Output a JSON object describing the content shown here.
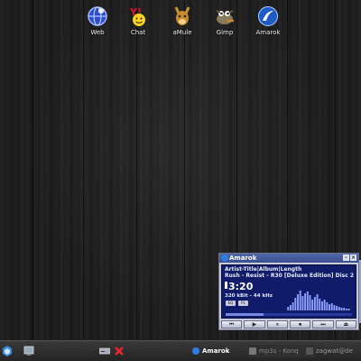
{
  "desktop": {
    "icons": [
      {
        "label": "Web",
        "icon": "web-browser-icon"
      },
      {
        "label": "Chat",
        "icon": "chat-icon"
      },
      {
        "label": "aMule",
        "icon": "amule-icon"
      },
      {
        "label": "Gimp",
        "icon": "gimp-icon"
      },
      {
        "label": "Amarok",
        "icon": "amarok-icon"
      }
    ]
  },
  "amarok": {
    "title": "Amarok",
    "line1": "Artist-Title|Album|Length",
    "line2": "Rush - Resist  -  R30 [Deluxe Edition] Disc 2",
    "time": "3:20",
    "bitrate": "320 kBit - 44 kHz",
    "progress": 0.3,
    "small_btn1": "EQ",
    "small_btn2": "PL",
    "controls": [
      "⏮",
      "▶",
      "⏸",
      "⏹",
      "⏭",
      "⏏"
    ],
    "analyzer_levels": [
      4,
      6,
      9,
      14,
      18,
      22,
      16,
      19,
      21,
      17,
      12,
      15,
      18,
      13,
      10,
      12,
      9,
      7,
      8,
      6,
      5,
      4,
      3,
      3,
      2,
      2
    ]
  },
  "taskbar": {
    "tasks": [
      {
        "label": "Amarok",
        "icon": "amarok-icon"
      },
      {
        "label": "mp3s - Konq",
        "icon": "konqueror-icon"
      },
      {
        "label": "zagwat@de",
        "icon": "terminal-icon"
      }
    ],
    "colors": {
      "accent": "#3a4f90",
      "panel": "#101c6a"
    }
  }
}
